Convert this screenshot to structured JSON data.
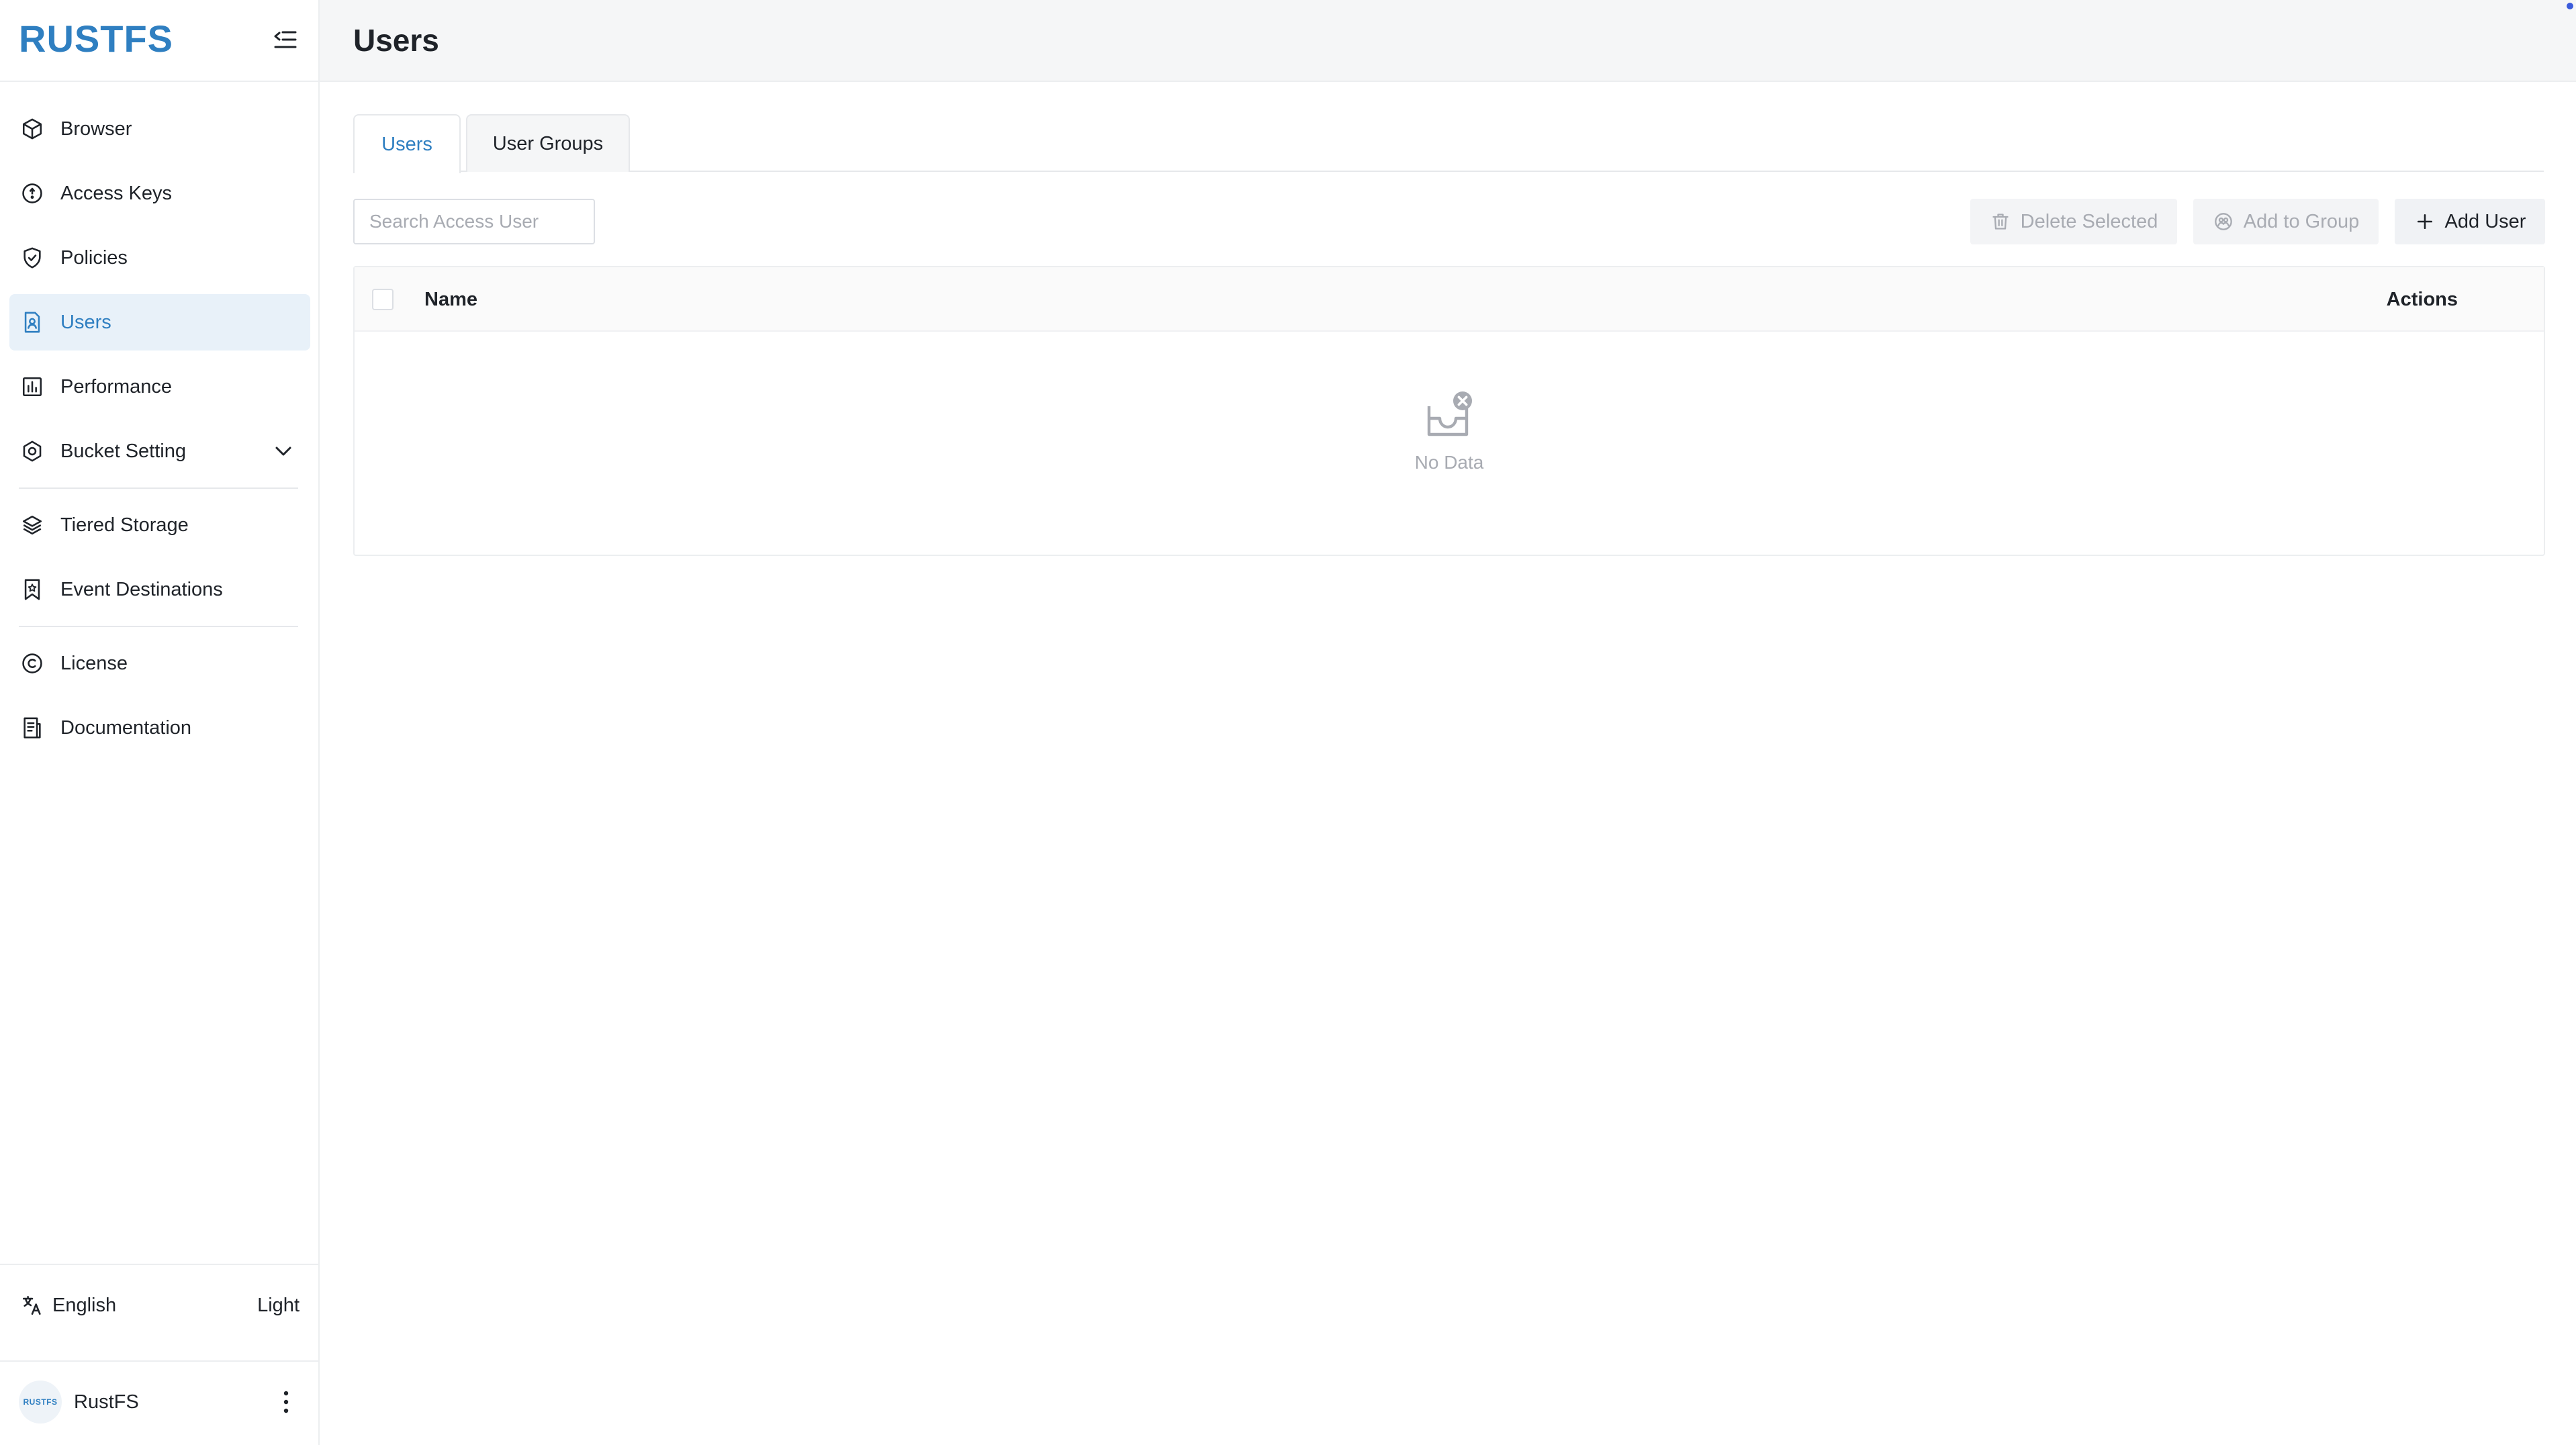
{
  "app": {
    "logo": "RUSTFS",
    "page_title": "Users"
  },
  "sidebar": {
    "items": [
      {
        "label": "Browser",
        "icon": "box-icon"
      },
      {
        "label": "Access Keys",
        "icon": "key-circle-icon"
      },
      {
        "label": "Policies",
        "icon": "shield-check-icon"
      },
      {
        "label": "Users",
        "icon": "user-file-icon",
        "active": true
      },
      {
        "label": "Performance",
        "icon": "bar-chart-icon"
      },
      {
        "label": "Bucket Setting",
        "icon": "gear-icon",
        "expandable": true
      },
      {
        "label": "Tiered Storage",
        "icon": "layers-icon"
      },
      {
        "label": "Event Destinations",
        "icon": "bookmark-star-icon"
      },
      {
        "label": "License",
        "icon": "copyright-icon"
      },
      {
        "label": "Documentation",
        "icon": "document-icon"
      }
    ],
    "footer": {
      "language": "English",
      "theme": "Light",
      "user_name": "RustFS",
      "avatar_text": "RUSTFS"
    }
  },
  "tabs": [
    {
      "label": "Users",
      "active": true
    },
    {
      "label": "User Groups",
      "active": false
    }
  ],
  "toolbar": {
    "search_placeholder": "Search Access User",
    "delete_label": "Delete Selected",
    "add_group_label": "Add to Group",
    "add_user_label": "Add User"
  },
  "table": {
    "columns": [
      "Name",
      "Actions"
    ],
    "rows": [],
    "empty_text": "No Data"
  },
  "colors": {
    "accent": "#2f7fc1",
    "active_bg": "#e8f1f9"
  }
}
